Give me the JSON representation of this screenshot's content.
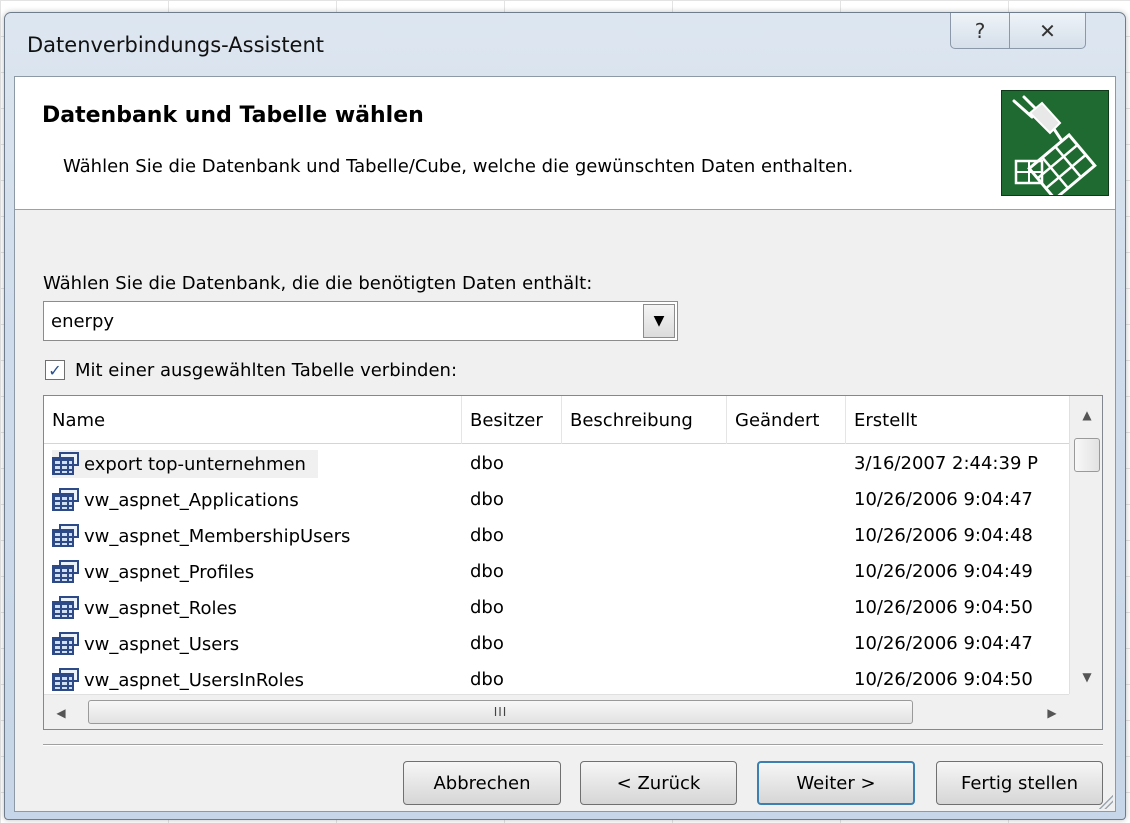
{
  "window": {
    "title": "Datenverbindungs-Assistent",
    "help_glyph": "?",
    "close_glyph": "✕"
  },
  "header": {
    "title": "Datenbank und Tabelle wählen",
    "subtitle": "Wählen Sie die Datenbank und Tabelle/Cube, welche die gewünschten Daten enthalten."
  },
  "database": {
    "label": "Wählen Sie die Datenbank, die die benötigten Daten enthält:",
    "selected": "enerpy"
  },
  "connect_checkbox": {
    "label": "Mit einer ausgewählten Tabelle verbinden:",
    "checked": true
  },
  "table_list": {
    "columns": [
      "Name",
      "Besitzer",
      "Beschreibung",
      "Geändert",
      "Erstellt"
    ],
    "rows": [
      {
        "name": "export top-unternehmen",
        "owner": "dbo",
        "description": "",
        "modified": "",
        "created": "3/16/2007 2:44:39 P",
        "selected": true
      },
      {
        "name": "vw_aspnet_Applications",
        "owner": "dbo",
        "description": "",
        "modified": "",
        "created": "10/26/2006 9:04:47"
      },
      {
        "name": "vw_aspnet_MembershipUsers",
        "owner": "dbo",
        "description": "",
        "modified": "",
        "created": "10/26/2006 9:04:48"
      },
      {
        "name": "vw_aspnet_Profiles",
        "owner": "dbo",
        "description": "",
        "modified": "",
        "created": "10/26/2006 9:04:49"
      },
      {
        "name": "vw_aspnet_Roles",
        "owner": "dbo",
        "description": "",
        "modified": "",
        "created": "10/26/2006 9:04:50"
      },
      {
        "name": "vw_aspnet_Users",
        "owner": "dbo",
        "description": "",
        "modified": "",
        "created": "10/26/2006 9:04:47"
      },
      {
        "name": "vw_aspnet_UsersInRoles",
        "owner": "dbo",
        "description": "",
        "modified": "",
        "created": "10/26/2006 9:04:50"
      }
    ],
    "hscroll_grip": "III"
  },
  "buttons": {
    "cancel": "Abbrechen",
    "back": "< Zurück",
    "next": "Weiter >",
    "finish": "Fertig stellen"
  },
  "colors": {
    "header_icon_bg": "#1e6a30",
    "default_button_border": "#3c7fb1",
    "checkbox_check": "#2c4e8c"
  }
}
